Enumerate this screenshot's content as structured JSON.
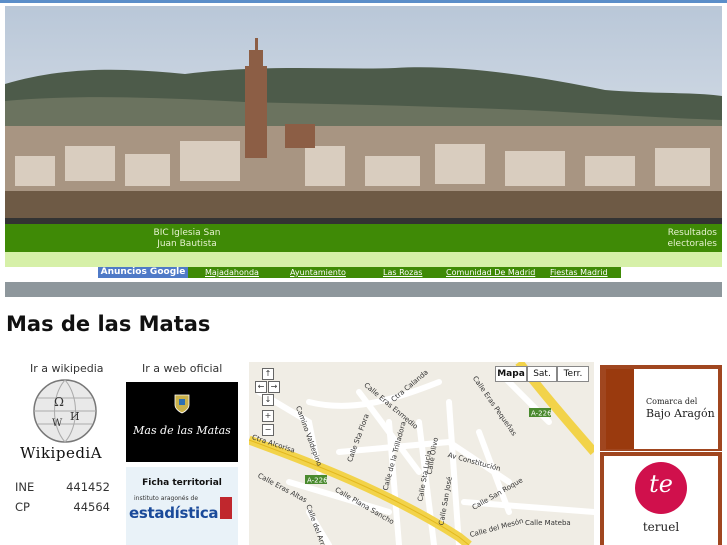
{
  "header": {
    "photo_caption_left": "BIC Iglesia San Juan Bautista",
    "photo_caption_right": "Resultados electorales"
  },
  "ads": {
    "brand": "Anuncios Google",
    "links": [
      "Majadahonda",
      "Ayuntamiento",
      "Las Rozas",
      "Comunidad De Madrid",
      "Fiestas Madrid"
    ]
  },
  "page": {
    "title": "Mas de las Matas"
  },
  "wikipedia": {
    "label": "Ir a wikipedia",
    "wordmark": "WikipediA"
  },
  "official_web": {
    "label": "Ir a web oficial",
    "banner_text": "Mas de las Matas"
  },
  "stats": [
    {
      "key": "INE",
      "value": "441452"
    },
    {
      "key": "CP",
      "value": "44564"
    }
  ],
  "ficha": {
    "title": "Ficha territorial",
    "institute": "instituto aragonés de",
    "brand": "estadística"
  },
  "map": {
    "type_buttons": [
      "Mapa",
      "Sat.",
      "Terr."
    ],
    "active_type": "Mapa",
    "nav_icons": [
      "pan-up-icon",
      "pan-left-icon",
      "pan-right-icon",
      "pan-down-icon",
      "zoom-in-icon",
      "zoom-out-icon"
    ],
    "street_labels": [
      "Ctra Calanda",
      "Calle Eras Enmedio",
      "Calle Eras Pequeñas",
      "Camino Valdepino",
      "Calle Sta Flora",
      "Calle de la Trilladora",
      "Calle Sta Lucia",
      "Calle Olivo",
      "Av Constitución",
      "Calle San José",
      "Calle Plana Sancho",
      "Ctra Alcorisa",
      "Calle Eras Altas",
      "Calle San Roque",
      "Calle del Mesón",
      "Calle Mateba",
      "Calle del Arrabal"
    ],
    "road_shields": [
      "A-226",
      "A-226"
    ]
  },
  "sponsors": {
    "comarca_line1": "Comarca del",
    "comarca_line2": "Bajo Aragón",
    "teruel_logo": "te",
    "teruel_name": "teruel"
  },
  "colors": {
    "green": "#3f8a06",
    "light_green": "#d6f0a8",
    "gray_bar": "#8e979c",
    "brand_blue": "#4f7ac7",
    "comarca_brown": "#a0461f",
    "teruel_magenta": "#d0104c"
  }
}
